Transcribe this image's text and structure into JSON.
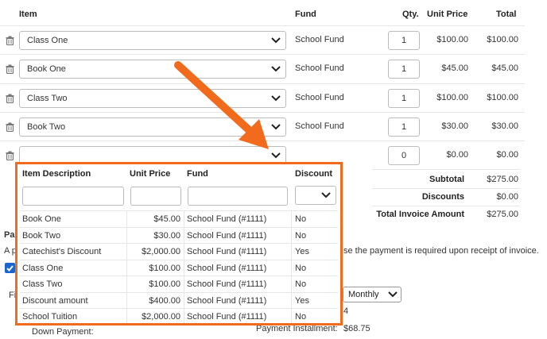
{
  "table": {
    "headers": {
      "item": "Item",
      "fund": "Fund",
      "qty": "Qty.",
      "unit_price": "Unit Price",
      "total": "Total"
    },
    "rows": [
      {
        "item": "Class One",
        "fund": "School Fund",
        "qty": "1",
        "unit_price": "$100.00",
        "total": "$100.00"
      },
      {
        "item": "Book One",
        "fund": "School Fund",
        "qty": "1",
        "unit_price": "$45.00",
        "total": "$45.00"
      },
      {
        "item": "Class Two",
        "fund": "School Fund",
        "qty": "1",
        "unit_price": "$100.00",
        "total": "$100.00"
      },
      {
        "item": "Book Two",
        "fund": "School Fund",
        "qty": "1",
        "unit_price": "$30.00",
        "total": "$30.00"
      },
      {
        "item": "",
        "fund": "",
        "qty": "0",
        "unit_price": "$0.00",
        "total": "$0.00"
      }
    ]
  },
  "summary": {
    "subtotal_label": "Subtotal",
    "subtotal_value": "$275.00",
    "discounts_label": "Discounts",
    "discounts_value": "$0.00",
    "total_label": "Total Invoice Amount",
    "total_value": "$275.00"
  },
  "background": {
    "section_heading_fragment": "Pa",
    "line_left_fragment": "A p",
    "line_right_fragment": "se the payment is required upon receipt of invoice.",
    "fi_fragment": "Fi",
    "frequency_select": "Monthly",
    "four_fragment": "4",
    "down_payment_label": "Down Payment:",
    "payment_installment_label": "Payment Installment:",
    "payment_installment_value": "$68.75"
  },
  "popup": {
    "headers": {
      "description": "Item Description",
      "unit_price": "Unit Price",
      "fund": "Fund",
      "discount": "Discount"
    },
    "rows": [
      {
        "description": "Book One",
        "unit_price": "$45.00",
        "fund": "School Fund (#1111)",
        "discount": "No"
      },
      {
        "description": "Book Two",
        "unit_price": "$30.00",
        "fund": "School Fund (#1111)",
        "discount": "No"
      },
      {
        "description": "Catechist's Discount",
        "unit_price": "$2,000.00",
        "fund": "School Fund (#1111)",
        "discount": "Yes"
      },
      {
        "description": "Class One",
        "unit_price": "$100.00",
        "fund": "School Fund (#1111)",
        "discount": "No"
      },
      {
        "description": "Class Two",
        "unit_price": "$100.00",
        "fund": "School Fund (#1111)",
        "discount": "No"
      },
      {
        "description": "Discount amount",
        "unit_price": "$400.00",
        "fund": "School Fund (#1111)",
        "discount": "Yes"
      },
      {
        "description": "School Tuition",
        "unit_price": "$2,000.00",
        "fund": "School Fund (#1111)",
        "discount": "No"
      }
    ]
  },
  "icons": {
    "trash": "trash-icon",
    "chevron": "chevron-down-icon",
    "checkbox": "checkmark-icon",
    "annotation": "arrow-annotation"
  },
  "colors": {
    "accent_orange": "#f26a1b",
    "checkbox_blue": "#1a66cc"
  }
}
